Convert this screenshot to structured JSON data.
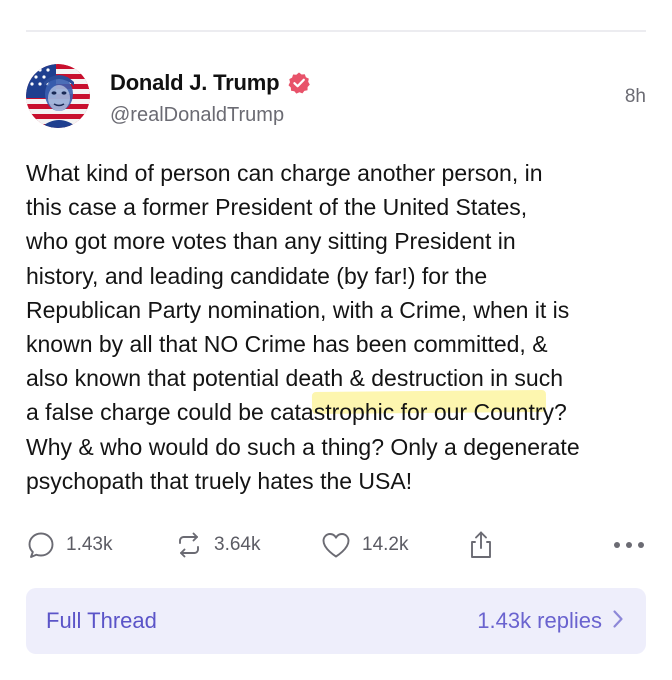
{
  "post": {
    "author_name": "Donald J. Trump",
    "handle": "@realDonaldTrump",
    "time": "8h",
    "verified_icon": "verified-badge-icon",
    "body": "What kind of person can charge another person, in\nthis case a former President of the United States,\nwho got more votes than any sitting President in\nhistory, and leading candidate (by far!) for the\nRepublican Party nomination, with a Crime, when it is\nknown by all that NO Crime has been committed, &\nalso known that potential death & destruction in such\na false charge could be catastrophic for our Country?\nWhy & who would do such a thing? Only a degenerate\npsychopath that truely hates the USA!"
  },
  "actions": {
    "replies": "1.43k",
    "reposts": "3.64k",
    "likes": "14.2k"
  },
  "thread": {
    "label": "Full Thread",
    "replies": "1.43k replies"
  },
  "colors": {
    "accent": "#5b54c8",
    "thread_bg": "#eeeefb",
    "verified": "#e8536a",
    "muted": "#6b6b73"
  }
}
